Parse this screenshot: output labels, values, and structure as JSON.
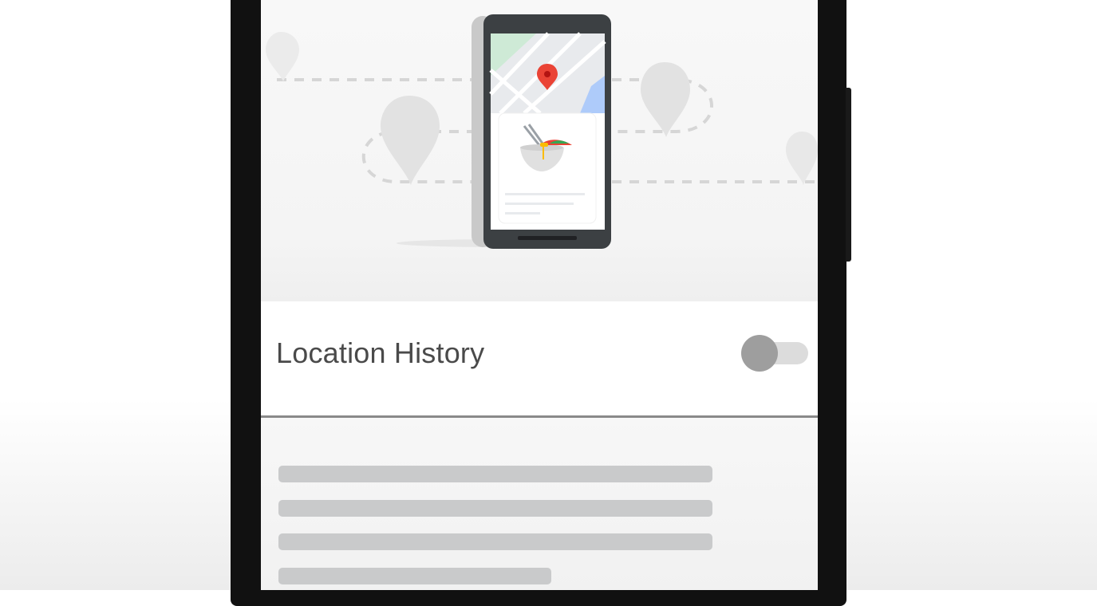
{
  "setting": {
    "label": "Location History",
    "toggle_state": "off"
  },
  "illustration": {
    "icons": [
      "map-pin-icon",
      "phone-icon",
      "food-bowl-icon"
    ],
    "pin_color": "#ea4335",
    "map_green": "#ceead6",
    "map_blue": "#aecbfa"
  },
  "colors": {
    "toggle_knob": "#9e9e9e",
    "toggle_track": "#dcdcdc",
    "text": "#4a4a4a",
    "placeholder_line": "#c9cacb"
  }
}
